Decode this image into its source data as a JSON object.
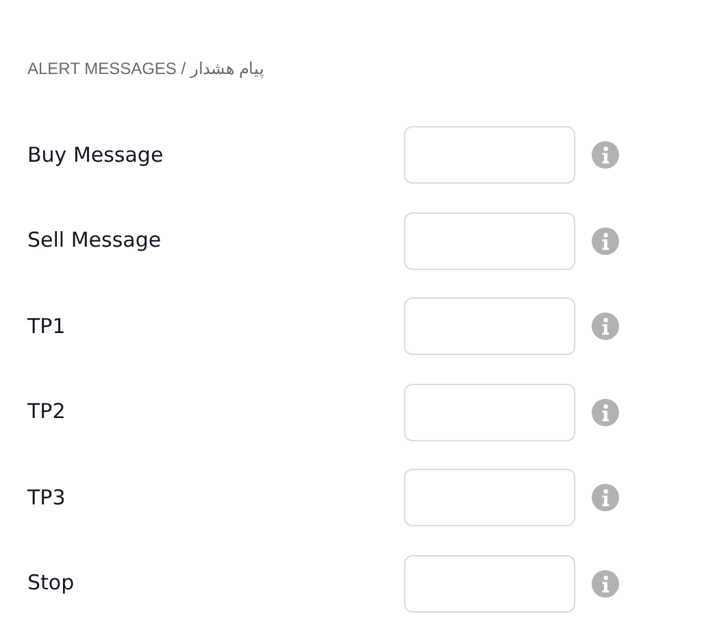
{
  "section_title": "ALERT MESSAGES / پیام هشدار",
  "fields": [
    {
      "label": "Buy Message"
    },
    {
      "label": "Sell Message"
    },
    {
      "label": "TP1"
    },
    {
      "label": "TP2"
    },
    {
      "label": "TP3"
    },
    {
      "label": "Stop"
    }
  ]
}
